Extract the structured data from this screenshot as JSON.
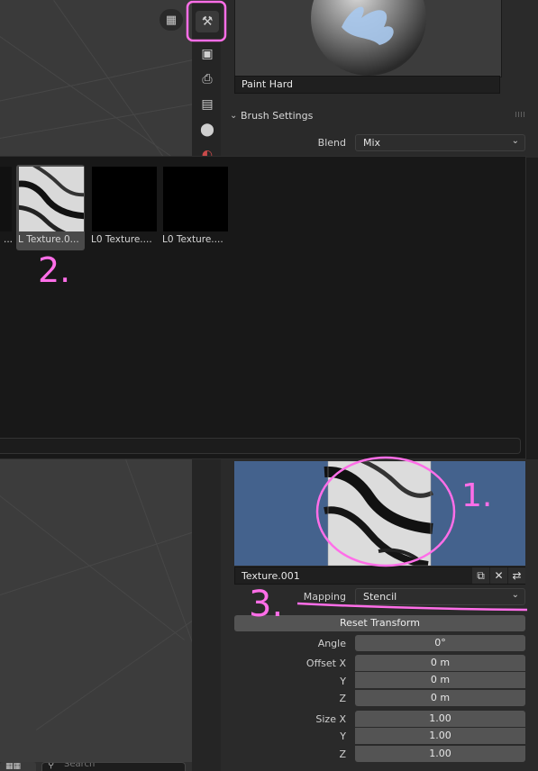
{
  "properties": {
    "brush_name": "Paint Hard",
    "brush_settings_header": "Brush Settings",
    "blend_label": "Blend",
    "blend_value": "Mix"
  },
  "texture_browser": {
    "items": [
      {
        "label": "...",
        "selected": false
      },
      {
        "label": "L  Texture.0...",
        "selected": true
      },
      {
        "label": "L0 Texture....",
        "selected": false
      },
      {
        "label": "L0 Texture....",
        "selected": false
      }
    ]
  },
  "texture": {
    "name": "Texture.001",
    "mapping_label": "Mapping",
    "mapping_value": "Stencil",
    "reset_transform_label": "Reset Transform",
    "angle_label": "Angle",
    "angle_value": "0°",
    "offset_x_label": "Offset X",
    "offset_x_value": "0 m",
    "offset_y_label": "Y",
    "offset_y_value": "0 m",
    "offset_z_label": "Z",
    "offset_z_value": "0 m",
    "size_x_label": "Size X",
    "size_x_value": "1.00",
    "size_y_label": "Y",
    "size_y_value": "1.00",
    "size_z_label": "Z",
    "size_z_value": "1.00"
  },
  "footer": {
    "search_placeholder": "Search"
  },
  "annotations": {
    "one": "1.",
    "two": "2.",
    "three": "3."
  },
  "colors": {
    "annotation": "#ff6ee8",
    "texture_preview_bg": "#44628d"
  },
  "icons": [
    "tool-settings-icon",
    "render-icon",
    "output-icon",
    "view-layer-icon",
    "scene-icon",
    "world-icon",
    "grid-view-icon",
    "duplicate-icon",
    "close-icon",
    "toggle-icon",
    "search-icon"
  ]
}
